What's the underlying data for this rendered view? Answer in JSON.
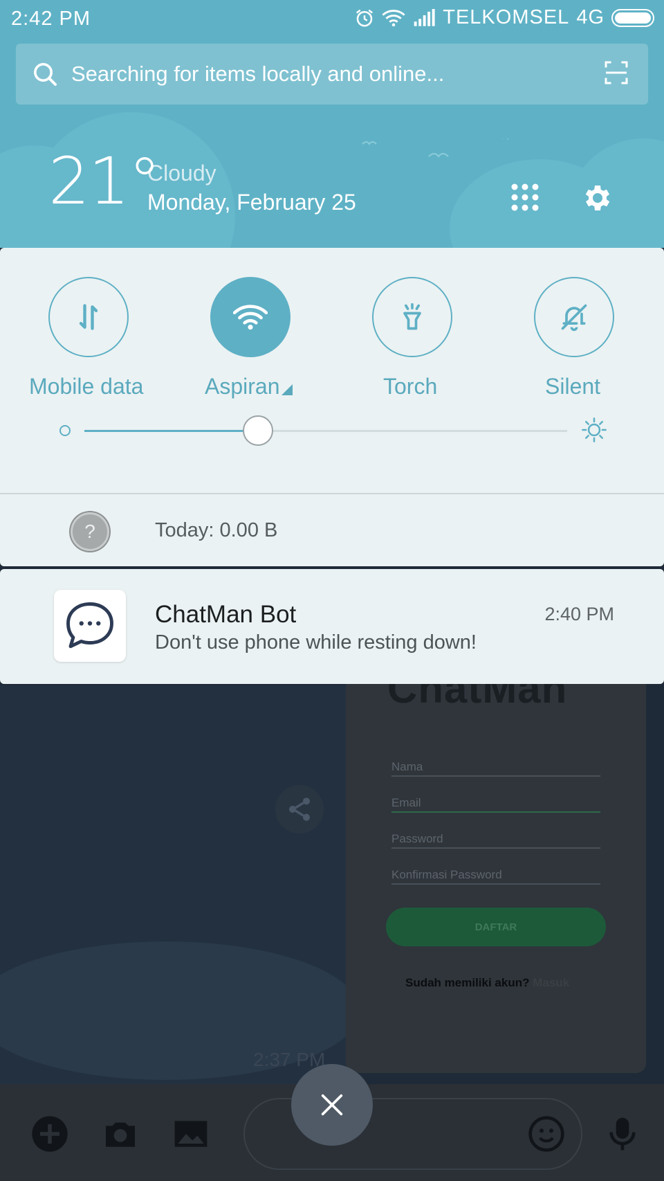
{
  "status_bar": {
    "time": "2:42 PM",
    "carrier": "TELKOMSEL",
    "network": "4G"
  },
  "search": {
    "placeholder": "Searching for items locally and online..."
  },
  "weather": {
    "temperature": "21°",
    "condition": "Cloudy",
    "date": "Monday, February 25"
  },
  "quick_settings": {
    "toggles": [
      {
        "label": "Mobile data",
        "icon": "mobile-data-icon",
        "on": false
      },
      {
        "label": "Aspiran",
        "icon": "wifi-icon",
        "on": true
      },
      {
        "label": "Torch",
        "icon": "torch-icon",
        "on": false
      },
      {
        "label": "Silent",
        "icon": "bell-off-icon",
        "on": false
      }
    ],
    "brightness_level": 0.36,
    "data_usage": "Today: 0.00 B"
  },
  "notification": {
    "app_name": "ChatMan Bot",
    "message": "Don't use phone while resting down!",
    "time": "2:40 PM"
  },
  "background_app": {
    "logo_text": "ChatMan",
    "fields": [
      "Nama",
      "Email",
      "Password",
      "Konfirmasi Password"
    ],
    "register_button": "DAFTAR",
    "signin_prompt": "Sudah memiliki akun?",
    "signin_link": "Masuk",
    "message_time": "2:37 PM"
  },
  "colors": {
    "accent": "#5eb0c5",
    "header_bg": "#5fb2c6",
    "panel_bg": "#ebf2f3"
  }
}
